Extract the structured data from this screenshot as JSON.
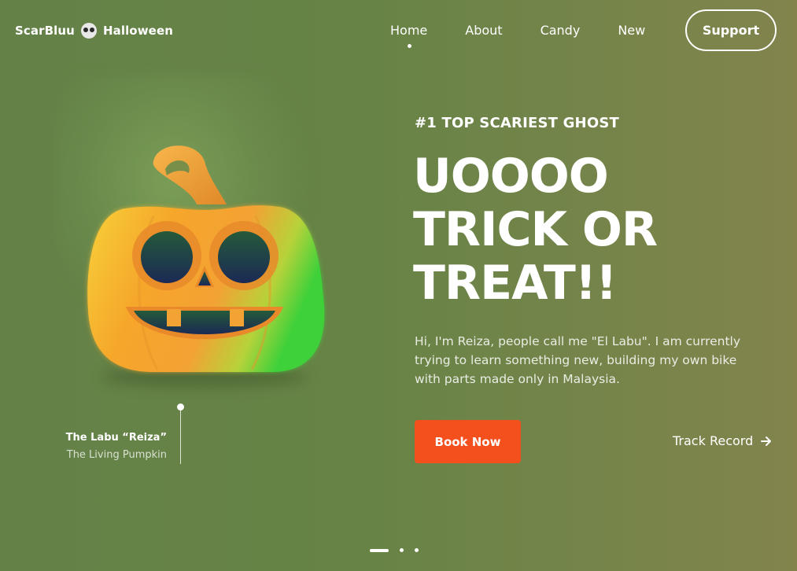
{
  "brand": {
    "name": "ScarBluu",
    "suffix": "Halloween",
    "icon": "skull-icon"
  },
  "nav": {
    "items": [
      {
        "label": "Home",
        "active": true
      },
      {
        "label": "About",
        "active": false
      },
      {
        "label": "Candy",
        "active": false
      },
      {
        "label": "New",
        "active": false
      }
    ],
    "support_label": "Support"
  },
  "hero": {
    "tagline": "#1 TOP SCARIEST GHOST",
    "headline_lines": [
      "UOOOO",
      "TRICK OR",
      "TREAT!!"
    ],
    "description": "Hi, I'm Reiza, people call me \"El Labu\". I am currently trying to learn something new, building my own bike with parts made only in Malaysia.",
    "cta_label": "Book Now",
    "secondary_label": "Track Record",
    "secondary_icon": "arrow-right-icon"
  },
  "character": {
    "name": "The Labu “Reiza”",
    "subtitle": "The Living Pumpkin",
    "image": "jack-o-lantern-pumpkin-icon"
  },
  "pager": {
    "slides": 3,
    "active": 1
  },
  "colors": {
    "accent": "#f4501e",
    "background": "#678346",
    "pumpkin": "#f5a623"
  }
}
